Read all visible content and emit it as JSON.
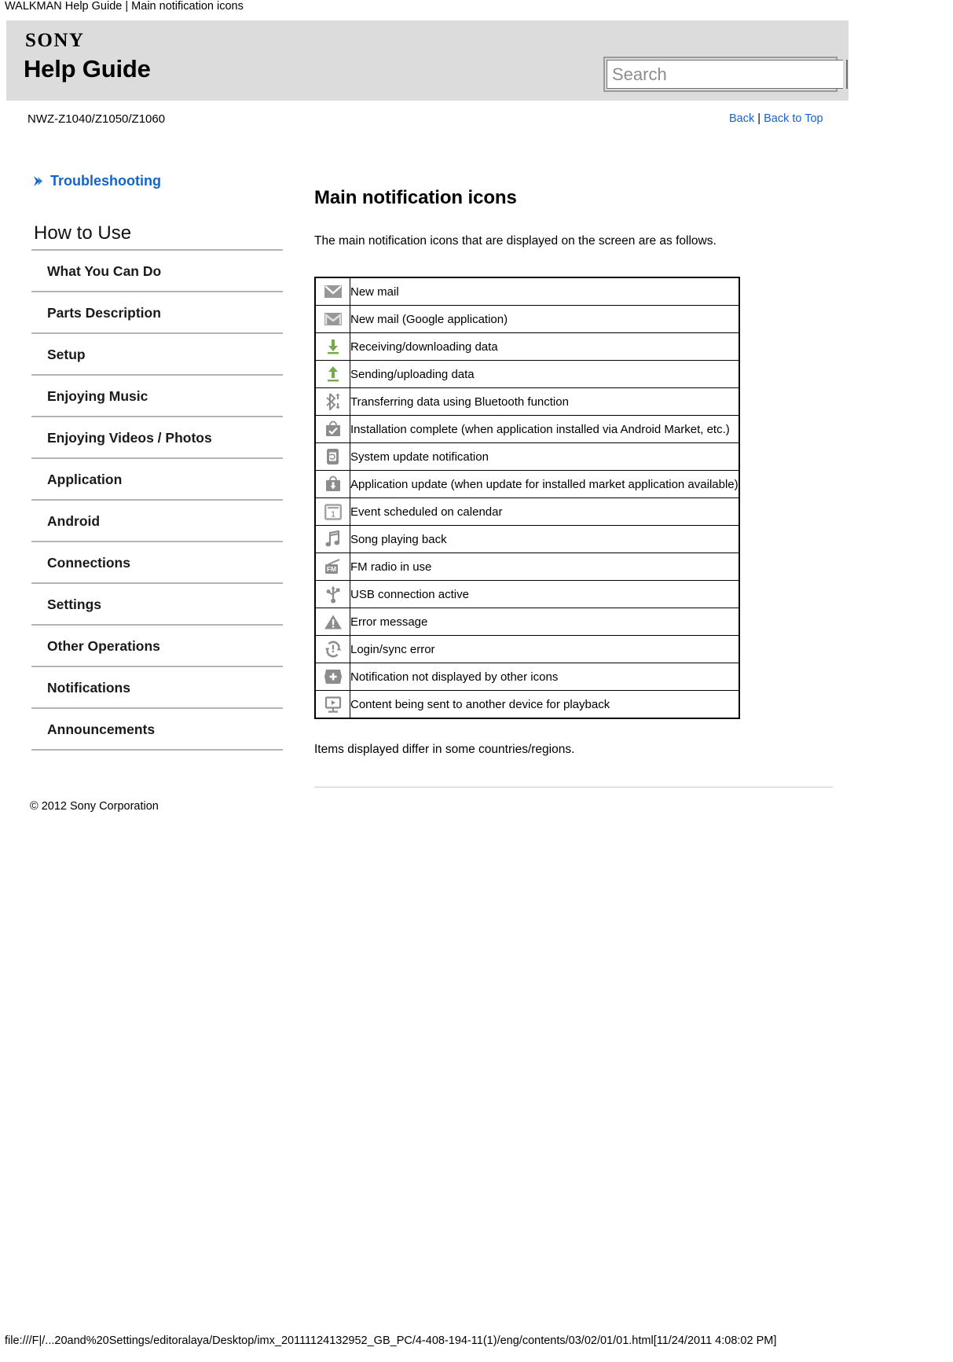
{
  "browser": {
    "print_header": "WALKMAN Help Guide | Main notification icons",
    "print_footer": "file:///F|/...20and%20Settings/editoralaya/Desktop/imx_20111124132952_GB_PC/4-408-194-11(1)/eng/contents/03/02/01/01.html[11/24/2011 4:08:02 PM]"
  },
  "banner": {
    "logo": "SONY",
    "title": "Help Guide",
    "search_placeholder": "Search",
    "search_value": "",
    "search_button_label": ""
  },
  "subheader": {
    "model": "NWZ-Z1040/Z1050/Z1060",
    "back_label": "Back",
    "separator": "|",
    "back_to_top_label": "Back to Top"
  },
  "sidebar": {
    "troubleshooting_label": "Troubleshooting",
    "section_heading": "How to Use",
    "items": [
      {
        "label": "What You Can Do"
      },
      {
        "label": "Parts Description"
      },
      {
        "label": "Setup"
      },
      {
        "label": "Enjoying Music"
      },
      {
        "label": "Enjoying Videos / Photos"
      },
      {
        "label": "Application"
      },
      {
        "label": "Android"
      },
      {
        "label": "Connections"
      },
      {
        "label": "Settings"
      },
      {
        "label": "Other Operations"
      },
      {
        "label": "Notifications"
      },
      {
        "label": "Announcements"
      }
    ]
  },
  "main": {
    "page_title": "Main notification icons",
    "intro": "The main notification icons that are displayed on the screen are as follows.",
    "note": "Items displayed differ in some countries/regions.",
    "table_rows": [
      {
        "icon": "new-mail-icon",
        "description": "New mail"
      },
      {
        "icon": "gmail-icon",
        "description": "New mail (Google application)"
      },
      {
        "icon": "download-arrow-icon",
        "description": "Receiving/downloading data"
      },
      {
        "icon": "upload-arrow-icon",
        "description": "Sending/uploading data"
      },
      {
        "icon": "bluetooth-transfer-icon",
        "description": "Transferring data using Bluetooth function"
      },
      {
        "icon": "install-complete-icon",
        "description": "Installation complete (when application installed via Android Market, etc.)"
      },
      {
        "icon": "system-update-icon",
        "description": "System update notification"
      },
      {
        "icon": "application-update-icon",
        "description": "Application update (when update for installed market application available)"
      },
      {
        "icon": "calendar-event-icon",
        "description": "Event scheduled on calendar"
      },
      {
        "icon": "music-note-icon",
        "description": "Song playing back"
      },
      {
        "icon": "fm-radio-icon",
        "description": "FM radio in use"
      },
      {
        "icon": "usb-icon",
        "description": "USB connection active"
      },
      {
        "icon": "warning-triangle-icon",
        "description": "Error message"
      },
      {
        "icon": "sync-error-icon",
        "description": "Login/sync error"
      },
      {
        "icon": "more-notifications-icon",
        "description": "Notification not displayed by other icons"
      },
      {
        "icon": "throw-to-device-icon",
        "description": "Content being sent to another device for playback"
      }
    ]
  },
  "footer": {
    "copyright": "© 2012 Sony Corporation"
  },
  "colors": {
    "banner_bg": "#dcdcdc",
    "link_blue": "#1a5fd6",
    "troubleshoot_blue": "#1464c8",
    "icon_gray": "#8c8c8c",
    "icon_green": "#7aa84f"
  }
}
